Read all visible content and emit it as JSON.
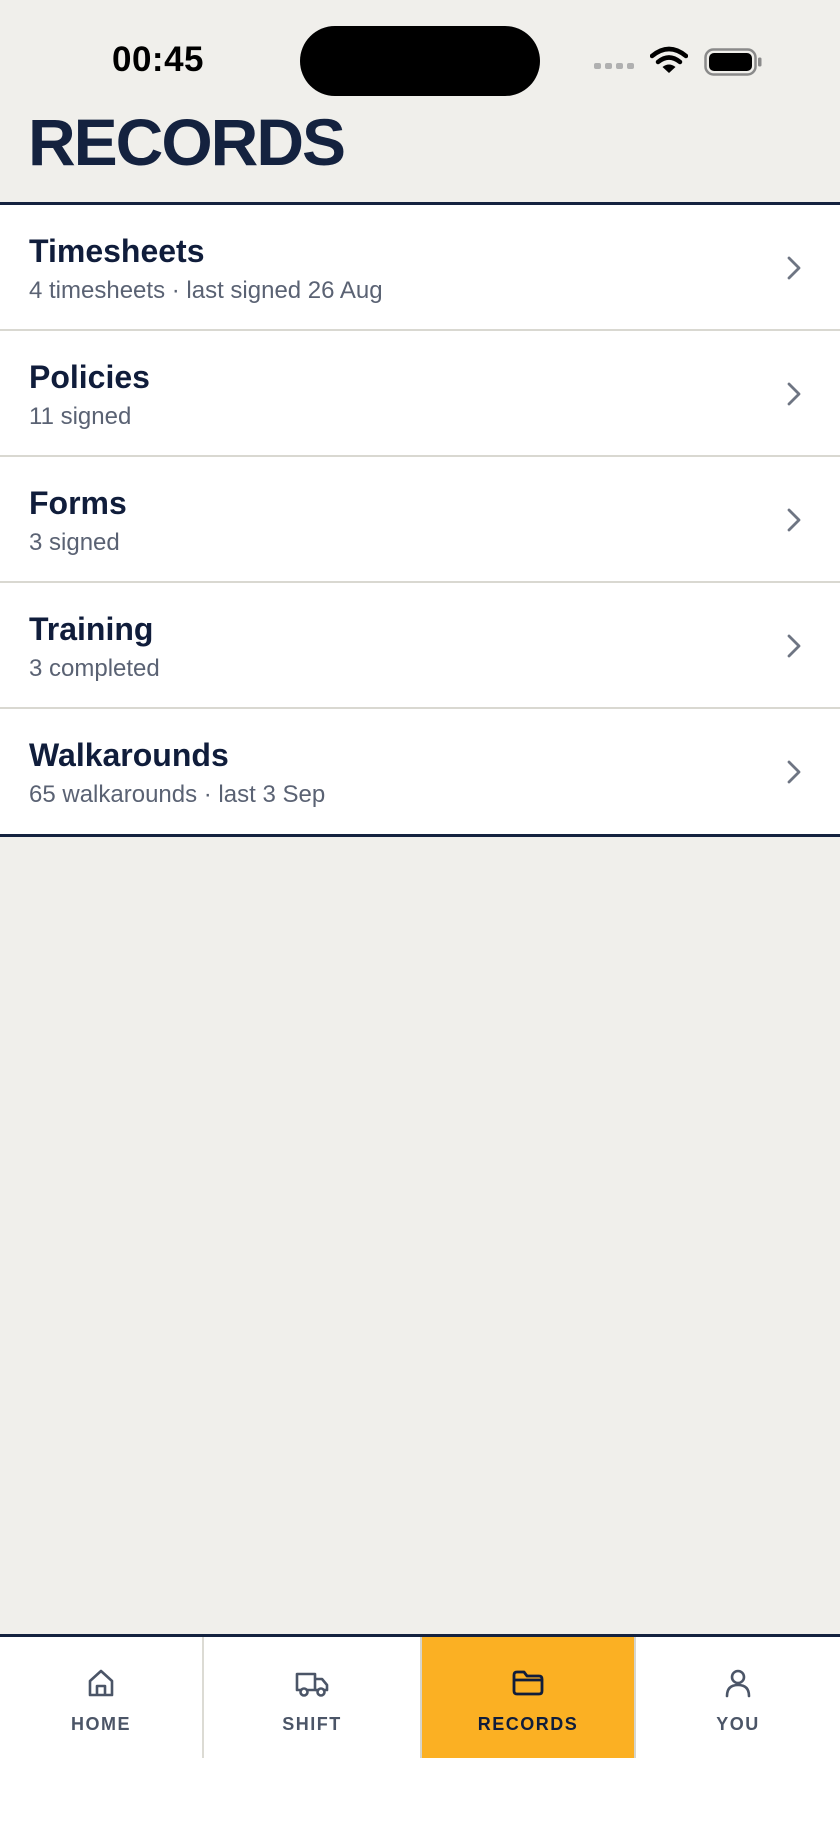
{
  "status_bar": {
    "time": "00:45",
    "icons": [
      "signal-icon",
      "wifi-icon",
      "battery-icon"
    ]
  },
  "page": {
    "title": "RECORDS"
  },
  "records": [
    {
      "title": "Timesheets",
      "subtitle": "4 timesheets · last signed 26 Aug"
    },
    {
      "title": "Policies",
      "subtitle": "11 signed"
    },
    {
      "title": "Forms",
      "subtitle": "3 signed"
    },
    {
      "title": "Training",
      "subtitle": "3 completed"
    },
    {
      "title": "Walkarounds",
      "subtitle": "65 walkarounds · last 3 Sep"
    }
  ],
  "tab_bar": {
    "tabs": [
      {
        "label": "HOME",
        "icon": "home-icon"
      },
      {
        "label": "SHIFT",
        "icon": "truck-icon"
      },
      {
        "label": "RECORDS",
        "icon": "folder-icon",
        "active": true
      },
      {
        "label": "YOU",
        "icon": "user-icon"
      }
    ]
  },
  "colors": {
    "background": "#f0efeb",
    "navy": "#14223f",
    "accent": "#fbb023",
    "row_background": "#ffffff"
  }
}
